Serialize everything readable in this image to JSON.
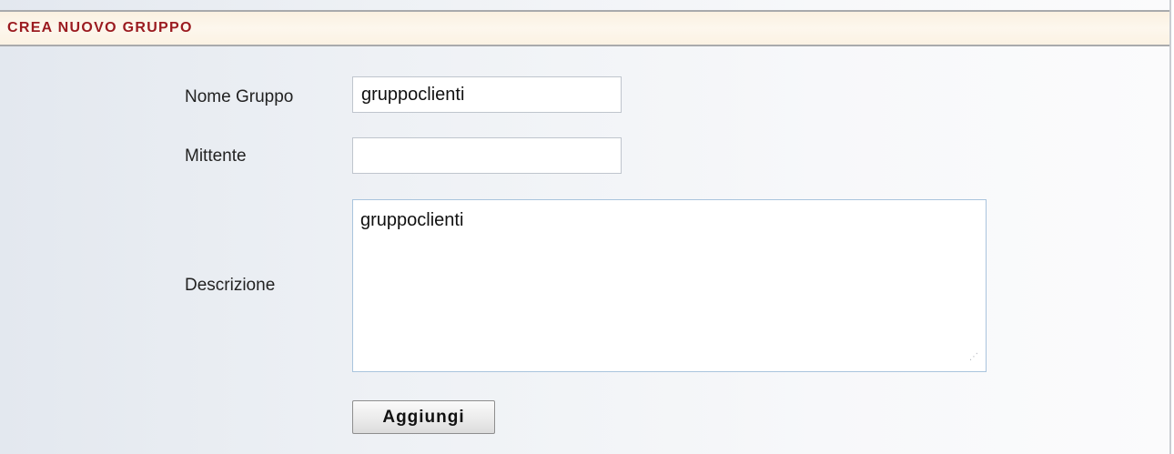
{
  "header": {
    "title": "CREA NUOVO GRUPPO"
  },
  "form": {
    "group_name": {
      "label": "Nome Gruppo",
      "value": "gruppoclienti"
    },
    "sender": {
      "label": "Mittente",
      "value": ""
    },
    "description": {
      "label": "Descrizione",
      "value": "gruppoclienti"
    },
    "submit_label": "Aggiungi"
  },
  "colors": {
    "header_text": "#9b1b20",
    "header_background": "#fbf1e1",
    "panel_background": "#e3e8ef"
  }
}
